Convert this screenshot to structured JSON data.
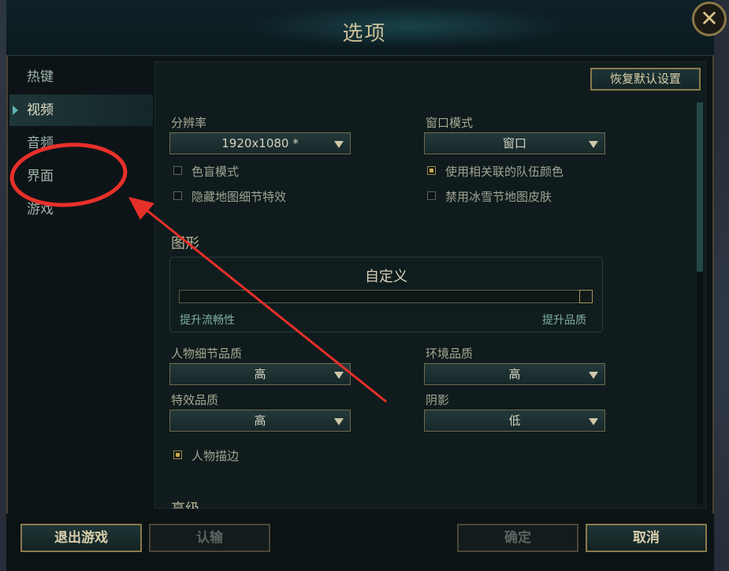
{
  "window": {
    "title": "选项",
    "close_glyph": "✕"
  },
  "sidebar": {
    "items": [
      {
        "label": "热键"
      },
      {
        "label": "视频"
      },
      {
        "label": "音频"
      },
      {
        "label": "界面"
      },
      {
        "label": "游戏"
      }
    ],
    "active_index": 1
  },
  "toolbar": {
    "reset_label": "恢复默认设置"
  },
  "video": {
    "resolution_label": "分辨率",
    "resolution_value": "1920x1080 *",
    "window_mode_label": "窗口模式",
    "window_mode_value": "窗口",
    "colorblind_label": "色盲模式",
    "colorblind_checked": false,
    "team_colors_label": "使用相关联的队伍颜色",
    "team_colors_checked": true,
    "hide_eyecandy_label": "隐藏地图细节特效",
    "hide_eyecandy_checked": false,
    "disable_snow_label": "禁用冰雪节地图皮肤",
    "disable_snow_checked": false
  },
  "graphics": {
    "section_label": "图形",
    "preset_label": "自定义",
    "slider_left_label": "提升流畅性",
    "slider_right_label": "提升品质",
    "slider_level": 1.0,
    "character_quality_label": "人物细节品质",
    "character_quality_value": "高",
    "environment_quality_label": "环境品质",
    "environment_quality_value": "高",
    "effects_quality_label": "特效品质",
    "effects_quality_value": "高",
    "shadows_label": "阴影",
    "shadows_value": "低",
    "character_inking_label": "人物描边",
    "character_inking_checked": true
  },
  "advanced": {
    "section_label": "高级"
  },
  "footer": {
    "exit_label": "退出游戏",
    "surrender_label": "认输",
    "ok_label": "确定",
    "cancel_label": "取消"
  },
  "annotation": {
    "color": "#e8302a"
  }
}
